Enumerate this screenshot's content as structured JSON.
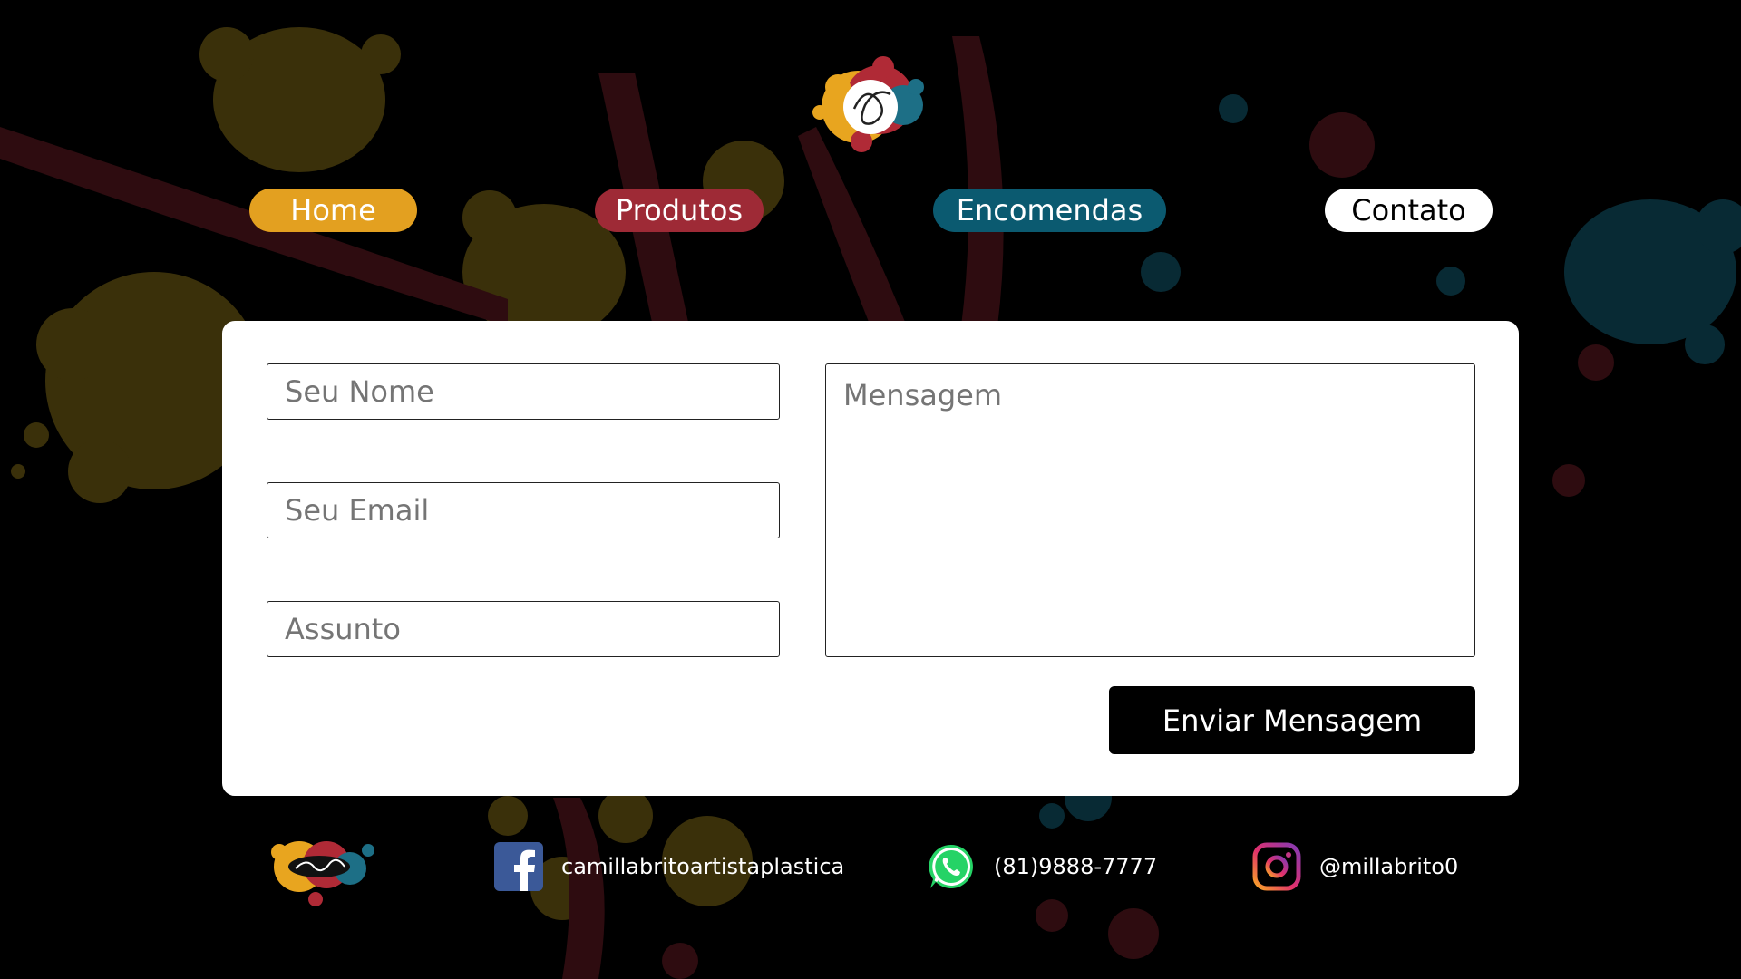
{
  "nav": {
    "home": "Home",
    "produtos": "Produtos",
    "encomendas": "Encomendas",
    "contato": "Contato"
  },
  "form": {
    "name_placeholder": "Seu Nome",
    "email_placeholder": "Seu Email",
    "subject_placeholder": "Assunto",
    "message_placeholder": "Mensagem",
    "submit_label": "Enviar Mensagem"
  },
  "footer": {
    "facebook": "camillabritoartistaplastica",
    "whatsapp": "(81)9888-7777",
    "instagram": "@millabrito0"
  },
  "colors": {
    "background": "#000000",
    "home": "#e3a020",
    "produtos": "#9e2a36",
    "encomendas": "#0b5a70",
    "contato": "#ffffff",
    "panel": "#ffffff",
    "submit": "#000000",
    "splash_yellow": "#3a300a",
    "splash_red": "#2e0c10",
    "splash_teal": "#082a34",
    "facebook": "#3b5998",
    "whatsapp": "#25d366"
  },
  "icons": {
    "logo": "paint-splash-logo",
    "facebook": "facebook-icon",
    "whatsapp": "whatsapp-icon",
    "instagram": "instagram-icon"
  }
}
